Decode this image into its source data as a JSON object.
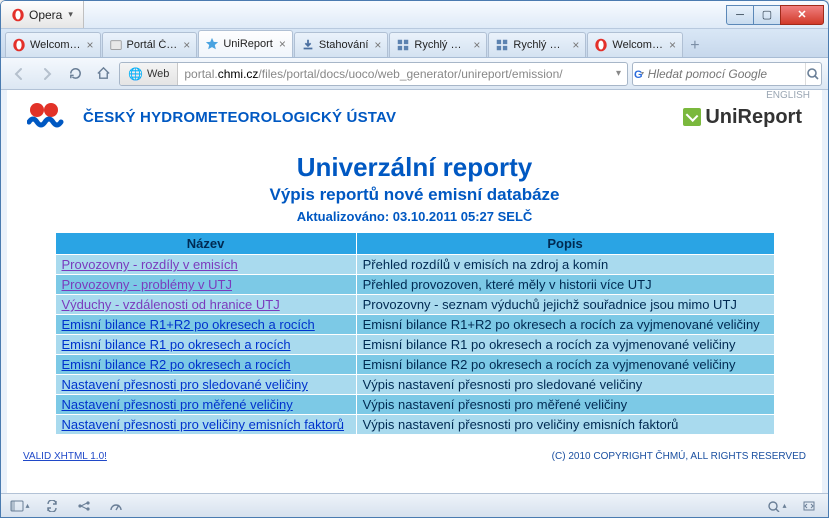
{
  "window": {
    "title": "Opera"
  },
  "tabs": [
    {
      "label": "Welcom…",
      "icon": "opera",
      "active": false
    },
    {
      "label": "Portál Č…",
      "icon": "generic",
      "active": false
    },
    {
      "label": "UniReport",
      "icon": "star",
      "active": true
    },
    {
      "label": "Stahování",
      "icon": "download",
      "active": false
    },
    {
      "label": "Rychlý p…",
      "icon": "grid",
      "active": false
    },
    {
      "label": "Rychlý p…",
      "icon": "grid",
      "active": false
    },
    {
      "label": "Welcom…",
      "icon": "opera",
      "active": false
    }
  ],
  "toolbar": {
    "chip": "Web",
    "url_pre": "portal.",
    "url_host": "chmi.cz",
    "url_path": "/files/portal/docs/uoco/web_generator/unireport/emission/",
    "search_placeholder": "Hledat pomocí Google"
  },
  "page": {
    "institute": "ČESKÝ HYDROMETEOROLOGICKÝ ÚSTAV",
    "brand": "UniReport",
    "english": "ENGLISH",
    "title": "Univerzální reporty",
    "subtitle": "Výpis reportů nové emisní databáze",
    "updated": "Aktualizováno: 03.10.2011 05:27 SELČ",
    "col_name": "Název",
    "col_desc": "Popis",
    "valid": "VALID XHTML 1.0!",
    "copyright": "(C) 2010 COPYRIGHT ČHMÚ, ALL RIGHTS RESERVED"
  },
  "reports": [
    {
      "name": "Provozovny - rozdíly v emisích",
      "desc": "Přehled rozdílů v emisích na zdroj a komín",
      "visited": true
    },
    {
      "name": "Provozovny - problémy v UTJ",
      "desc": "Přehled provozoven, které měly v historii více UTJ",
      "visited": true
    },
    {
      "name": "Výduchy - vzdálenosti od hranice UTJ",
      "desc": "Provozovny - seznam výduchů jejichž souřadnice jsou mimo UTJ",
      "visited": true
    },
    {
      "name": "Emisní bilance R1+R2 po okresech a rocích",
      "desc": "Emisní bilance R1+R2 po okresech a rocích za vyjmenované veličiny",
      "visited": false
    },
    {
      "name": "Emisní bilance R1 po okresech a rocích",
      "desc": "Emisní bilance R1 po okresech a rocích za vyjmenované veličiny",
      "visited": false
    },
    {
      "name": "Emisní bilance R2 po okresech a rocích",
      "desc": "Emisní bilance R2 po okresech a rocích za vyjmenované veličiny",
      "visited": false
    },
    {
      "name": "Nastavení přesnosti pro sledované veličiny",
      "desc": "Výpis nastavení přesnosti pro sledované veličiny",
      "visited": false
    },
    {
      "name": "Nastavení přesnosti pro měřené veličiny",
      "desc": "Výpis nastavení přesnosti pro měřené veličiny",
      "visited": false
    },
    {
      "name": "Nastavení přesnosti pro veličiny emisních faktorů",
      "desc": "Výpis nastavení přesnosti pro veličiny emisních faktorů",
      "visited": false
    }
  ]
}
